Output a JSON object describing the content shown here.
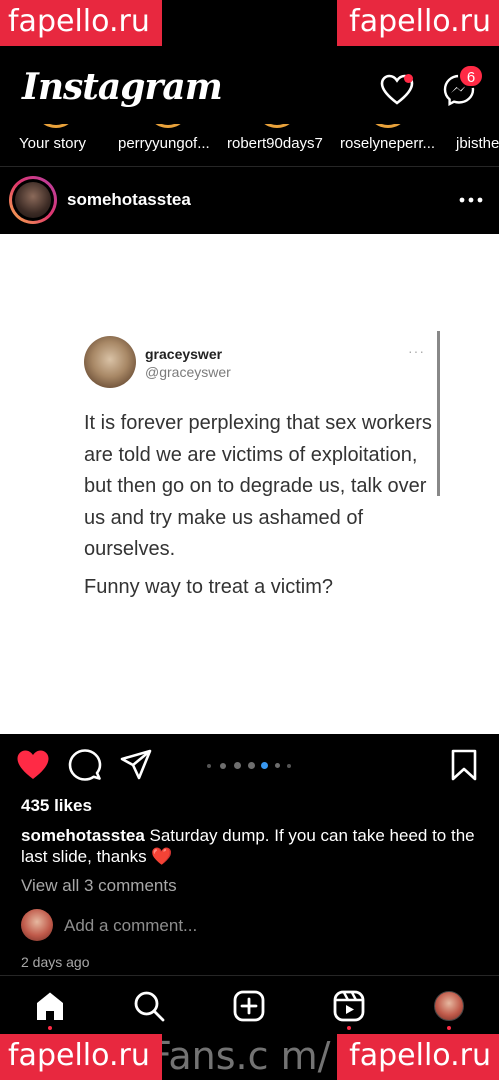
{
  "watermarks": {
    "top_left": "fapello.ru",
    "top_right": "fapello.ru",
    "bottom_left": "fapello.ru",
    "bottom_right": "fapello.ru",
    "center": "Fans.c m/"
  },
  "header": {
    "app_title": "Instagram",
    "messages_badge": "6",
    "icons": [
      "heart-icon",
      "messenger-icon"
    ]
  },
  "stories": [
    {
      "label": "Your story"
    },
    {
      "label": "perryyungof..."
    },
    {
      "label": "robert90days7"
    },
    {
      "label": "roselyneperr..."
    },
    {
      "label": "jbisthe"
    }
  ],
  "post": {
    "username": "somehotasstea",
    "tweet": {
      "name": "graceyswer",
      "handle": "@graceyswer",
      "more": "···",
      "text": "It is forever perplexing that sex workers are told we are victims of exploitation, but then go on to degrade us, talk over us and try make us ashamed of ourselves.",
      "text2": "Funny way to treat a victim?"
    },
    "carousel": {
      "count": 6,
      "active_index": 4
    },
    "likes": "435 likes",
    "caption_user": "somehotasstea",
    "caption_text": "Saturday dump. If you can take heed to the last slide, thanks ❤️",
    "view_comments": "View all 3 comments",
    "add_comment_placeholder": "Add a comment...",
    "time_ago": "2 days ago",
    "liked": true
  },
  "bottom_nav": {
    "items": [
      "home-icon",
      "search-icon",
      "create-icon",
      "reels-icon",
      "profile-avatar"
    ]
  },
  "colors": {
    "accent_red": "#ff2a45",
    "watermark": "#e8283f",
    "background": "#000000"
  }
}
